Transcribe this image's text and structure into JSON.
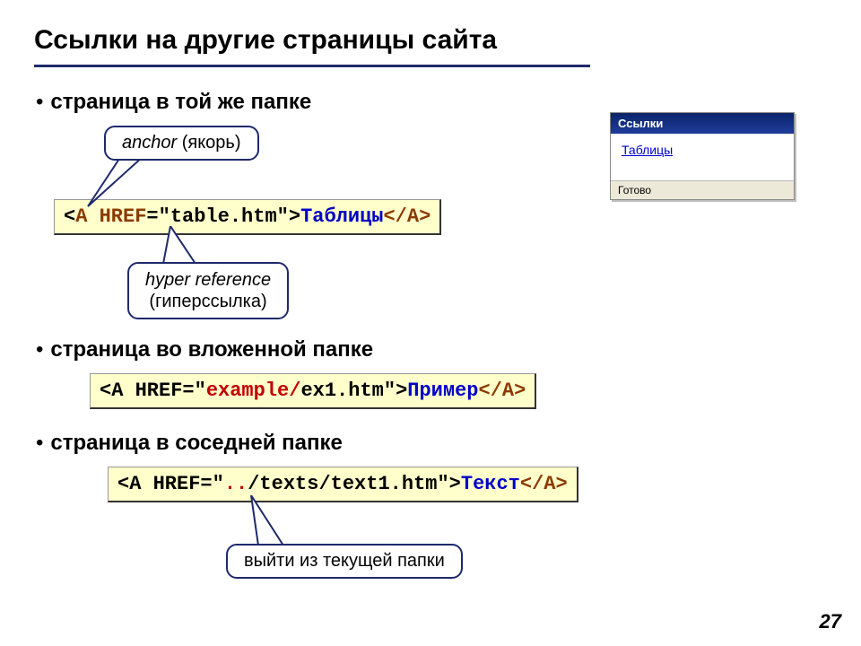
{
  "title": "Ссылки на другие страницы сайта",
  "bullets": {
    "b1": "страница в той же папке",
    "b2": "страница во вложенной папке",
    "b3": "страница в соседней папке"
  },
  "callouts": {
    "anchor_it": "anchor",
    "anchor_ru": " (якорь)",
    "hyper_it": "hyper reference",
    "hyper_ru": "(гиперссылка)",
    "updir": "выйти из текущей папки"
  },
  "code1": {
    "lt": "<",
    "tag_open": "A",
    "sp": " ",
    "attr": "HREF",
    "eqq1": "=\"",
    "href": "table.htm",
    "q2gt": "\">",
    "text": "Таблицы",
    "close": "</A>"
  },
  "code2": {
    "pre": "<A HREF=\"",
    "folder": "example/",
    "file": "ex1.htm",
    "mid": "\">",
    "text": "Пример",
    "close": "</A>"
  },
  "code3": {
    "pre": "<A HREF=\"",
    "dots": "..",
    "path": "/texts/text1.htm",
    "mid": "\">",
    "text": "Текст",
    "close": "</A>"
  },
  "window": {
    "title": "Ссылки",
    "link": "Таблицы",
    "status": "Готово"
  },
  "pagenum": "27"
}
